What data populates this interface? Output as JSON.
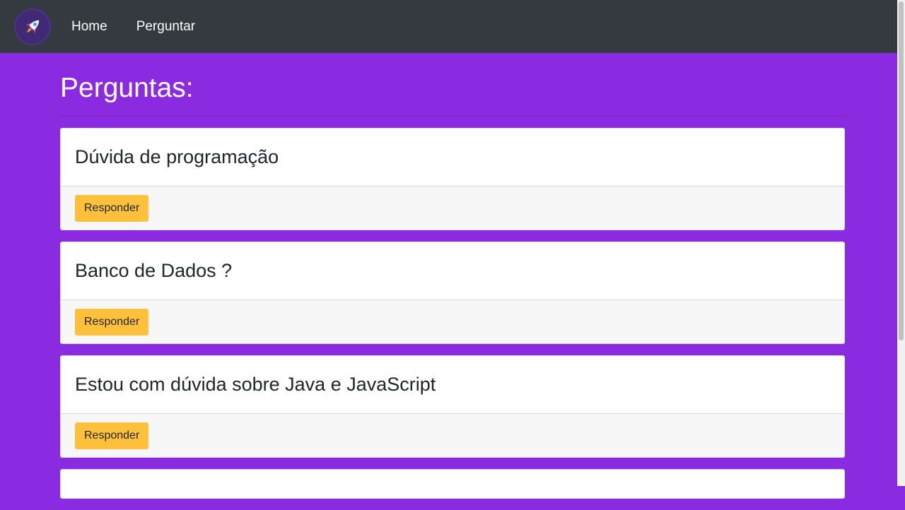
{
  "nav": {
    "logo_icon": "rocket-icon",
    "links": [
      "Home",
      "Perguntar"
    ]
  },
  "main": {
    "title": "Perguntas:",
    "questions": [
      {
        "title": "Dúvida de programação",
        "button": "Responder"
      },
      {
        "title": "Banco de Dados ?",
        "button": "Responder"
      },
      {
        "title": "Estou com dúvida sobre Java e JavaScript",
        "button": "Responder"
      }
    ]
  },
  "colors": {
    "page_background": "#8a2be2",
    "navbar": "#343a40",
    "button": "#ffc13b"
  }
}
